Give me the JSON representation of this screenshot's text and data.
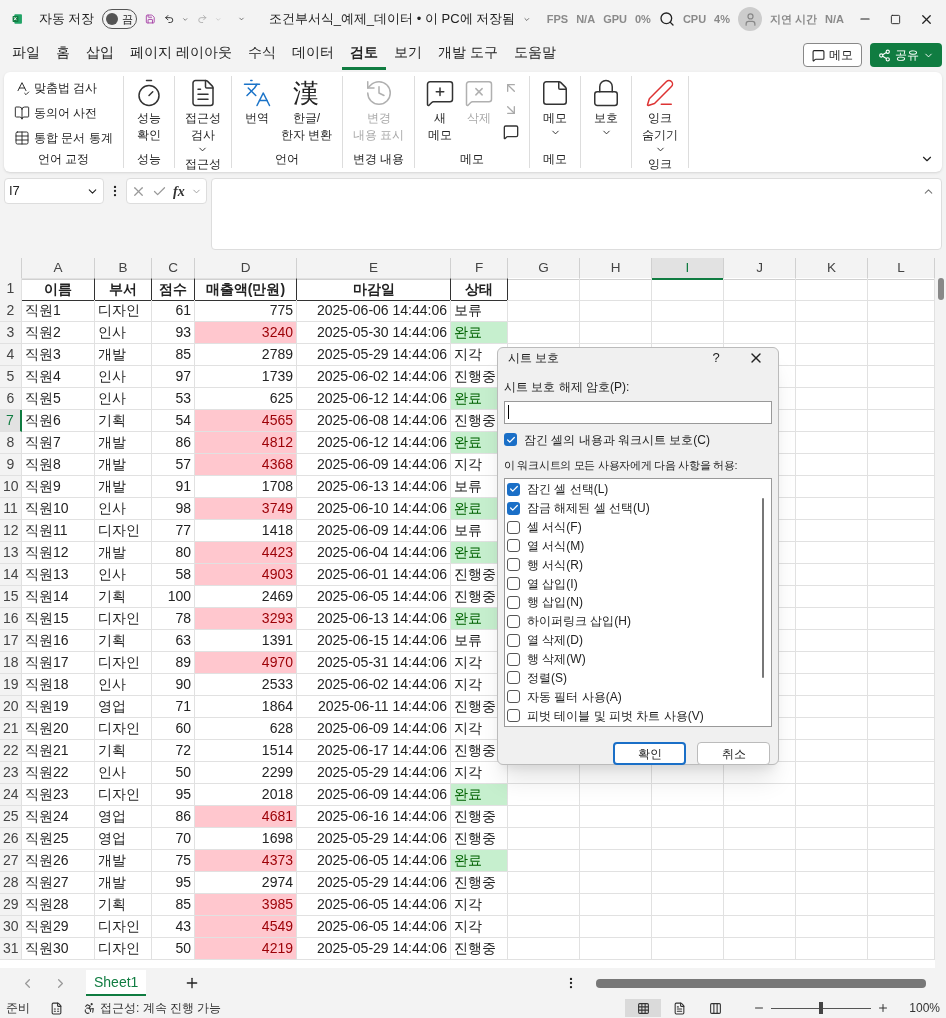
{
  "title_bar": {
    "autosave_label": "자동 저장",
    "autosave_toggle": {
      "label": "끔",
      "on": false
    },
    "title": "조건부서식_예제_데이터 • 이 PC에 저장됨",
    "overlay": [
      "FPS",
      "N/A",
      "GPU",
      "0%",
      "CPU",
      "4%",
      "지연 시간",
      "N/A"
    ]
  },
  "menu_tabs": [
    {
      "label": "파일",
      "selected": false
    },
    {
      "label": "홈",
      "selected": false
    },
    {
      "label": "삽입",
      "selected": false
    },
    {
      "label": "페이지 레이아웃",
      "selected": false
    },
    {
      "label": "수식",
      "selected": false
    },
    {
      "label": "데이터",
      "selected": false
    },
    {
      "label": "검토",
      "selected": true
    },
    {
      "label": "보기",
      "selected": false
    },
    {
      "label": "개발 도구",
      "selected": false
    },
    {
      "label": "도움말",
      "selected": false
    }
  ],
  "comment_button": "메모",
  "share_button": "공유",
  "ribbon": [
    {
      "label": "언어 교정",
      "buttons": [
        {
          "kind": "small",
          "lines": [
            "맞춤법 검사"
          ],
          "disabled": false
        },
        {
          "kind": "small",
          "lines": [
            "동의어 사전"
          ],
          "disabled": false
        },
        {
          "kind": "small",
          "lines": [
            "통합 문서 통계"
          ],
          "disabled": false
        }
      ]
    },
    {
      "label": "성능",
      "buttons": [
        {
          "kind": "large",
          "lines": [
            "성능",
            "확인"
          ],
          "disabled": false
        }
      ]
    },
    {
      "label": "접근성",
      "buttons": [
        {
          "kind": "large",
          "lines": [
            "접근성",
            "검사"
          ],
          "dropdown": true,
          "disabled": false
        }
      ]
    },
    {
      "label": "언어",
      "buttons": [
        {
          "kind": "large",
          "lines": [
            "번역"
          ],
          "disabled": false
        },
        {
          "kind": "large",
          "glyph": "漢",
          "lines": [
            "한글/",
            "한자 변환"
          ],
          "disabled": false
        }
      ]
    },
    {
      "label": "변경 내용",
      "buttons": [
        {
          "kind": "large",
          "lines": [
            "변경",
            "내용 표시"
          ],
          "disabled": true
        }
      ]
    },
    {
      "label": "메모",
      "buttons": [
        {
          "kind": "large",
          "lines": [
            "새",
            "메모"
          ],
          "disabled": false
        },
        {
          "kind": "large",
          "lines": [
            "삭제"
          ],
          "disabled": true
        },
        {
          "kind": "icons",
          "disabled": true
        }
      ]
    },
    {
      "label": "메모",
      "buttons": [
        {
          "kind": "large",
          "lines": [
            "메모"
          ],
          "dropdown": true,
          "disabled": false
        }
      ]
    },
    {
      "buttons": [
        {
          "kind": "large",
          "lines": [
            "보호"
          ],
          "dropdown": true,
          "disabled": false
        }
      ]
    },
    {
      "label": "잉크",
      "buttons": [
        {
          "kind": "large",
          "lines": [
            "잉크",
            "숨기기"
          ],
          "dropdown": true,
          "disabled": false
        }
      ]
    }
  ],
  "formula_bar": {
    "name_box": "I7",
    "fx": "fx"
  },
  "columns": [
    {
      "letter": "A",
      "selected": false
    },
    {
      "letter": "B",
      "selected": false
    },
    {
      "letter": "C",
      "selected": false
    },
    {
      "letter": "D",
      "selected": false
    },
    {
      "letter": "E",
      "selected": false
    },
    {
      "letter": "F",
      "selected": false
    },
    {
      "letter": "G",
      "selected": false
    },
    {
      "letter": "H",
      "selected": false
    },
    {
      "letter": "I",
      "selected": true
    },
    {
      "letter": "J",
      "selected": false
    },
    {
      "letter": "K",
      "selected": false
    },
    {
      "letter": "L",
      "selected": false
    }
  ],
  "header_row": {
    "row": "1",
    "cells": [
      "이름",
      "부서",
      "점수",
      "매출액(만원)",
      "마감일",
      "상태"
    ]
  },
  "rows": [
    {
      "row": "2",
      "name": "직원1",
      "dept": "디자인",
      "score": "61",
      "sales": "775",
      "sales_high": false,
      "deadline": "2025-06-06 14:44:06",
      "status": "보류",
      "status_done": false,
      "selected": false
    },
    {
      "row": "3",
      "name": "직원2",
      "dept": "인사",
      "score": "93",
      "sales": "3240",
      "sales_high": true,
      "deadline": "2025-05-30 14:44:06",
      "status": "완료",
      "status_done": true,
      "selected": false
    },
    {
      "row": "4",
      "name": "직원3",
      "dept": "개발",
      "score": "85",
      "sales": "2789",
      "sales_high": false,
      "deadline": "2025-05-29 14:44:06",
      "status": "지각",
      "status_done": false,
      "selected": false
    },
    {
      "row": "5",
      "name": "직원4",
      "dept": "인사",
      "score": "97",
      "sales": "1739",
      "sales_high": false,
      "deadline": "2025-06-02 14:44:06",
      "status": "진행중",
      "status_done": false,
      "selected": false
    },
    {
      "row": "6",
      "name": "직원5",
      "dept": "인사",
      "score": "53",
      "sales": "625",
      "sales_high": false,
      "deadline": "2025-06-12 14:44:06",
      "status": "완료",
      "status_done": true,
      "selected": false
    },
    {
      "row": "7",
      "name": "직원6",
      "dept": "기획",
      "score": "54",
      "sales": "4565",
      "sales_high": true,
      "deadline": "2025-06-08 14:44:06",
      "status": "진행중",
      "status_done": false,
      "selected": true
    },
    {
      "row": "8",
      "name": "직원7",
      "dept": "개발",
      "score": "86",
      "sales": "4812",
      "sales_high": true,
      "deadline": "2025-06-12 14:44:06",
      "status": "완료",
      "status_done": true,
      "selected": false
    },
    {
      "row": "9",
      "name": "직원8",
      "dept": "개발",
      "score": "57",
      "sales": "4368",
      "sales_high": true,
      "deadline": "2025-06-09 14:44:06",
      "status": "지각",
      "status_done": false,
      "selected": false
    },
    {
      "row": "10",
      "name": "직원9",
      "dept": "개발",
      "score": "91",
      "sales": "1708",
      "sales_high": false,
      "deadline": "2025-06-13 14:44:06",
      "status": "보류",
      "status_done": false,
      "selected": false
    },
    {
      "row": "11",
      "name": "직원10",
      "dept": "인사",
      "score": "98",
      "sales": "3749",
      "sales_high": true,
      "deadline": "2025-06-10 14:44:06",
      "status": "완료",
      "status_done": true,
      "selected": false
    },
    {
      "row": "12",
      "name": "직원11",
      "dept": "디자인",
      "score": "77",
      "sales": "1418",
      "sales_high": false,
      "deadline": "2025-06-09 14:44:06",
      "status": "보류",
      "status_done": false,
      "selected": false
    },
    {
      "row": "13",
      "name": "직원12",
      "dept": "개발",
      "score": "80",
      "sales": "4423",
      "sales_high": true,
      "deadline": "2025-06-04 14:44:06",
      "status": "완료",
      "status_done": true,
      "selected": false
    },
    {
      "row": "14",
      "name": "직원13",
      "dept": "인사",
      "score": "58",
      "sales": "4903",
      "sales_high": true,
      "deadline": "2025-06-01 14:44:06",
      "status": "진행중",
      "status_done": false,
      "selected": false
    },
    {
      "row": "15",
      "name": "직원14",
      "dept": "기획",
      "score": "100",
      "sales": "2469",
      "sales_high": false,
      "deadline": "2025-06-05 14:44:06",
      "status": "진행중",
      "status_done": false,
      "selected": false
    },
    {
      "row": "16",
      "name": "직원15",
      "dept": "디자인",
      "score": "78",
      "sales": "3293",
      "sales_high": true,
      "deadline": "2025-06-13 14:44:06",
      "status": "완료",
      "status_done": true,
      "selected": false
    },
    {
      "row": "17",
      "name": "직원16",
      "dept": "기획",
      "score": "63",
      "sales": "1391",
      "sales_high": false,
      "deadline": "2025-06-15 14:44:06",
      "status": "보류",
      "status_done": false,
      "selected": false
    },
    {
      "row": "18",
      "name": "직원17",
      "dept": "디자인",
      "score": "89",
      "sales": "4970",
      "sales_high": true,
      "deadline": "2025-05-31 14:44:06",
      "status": "지각",
      "status_done": false,
      "selected": false
    },
    {
      "row": "19",
      "name": "직원18",
      "dept": "인사",
      "score": "90",
      "sales": "2533",
      "sales_high": false,
      "deadline": "2025-06-02 14:44:06",
      "status": "지각",
      "status_done": false,
      "selected": false
    },
    {
      "row": "20",
      "name": "직원19",
      "dept": "영업",
      "score": "71",
      "sales": "1864",
      "sales_high": false,
      "deadline": "2025-06-11 14:44:06",
      "status": "진행중",
      "status_done": false,
      "selected": false
    },
    {
      "row": "21",
      "name": "직원20",
      "dept": "디자인",
      "score": "60",
      "sales": "628",
      "sales_high": false,
      "deadline": "2025-06-09 14:44:06",
      "status": "지각",
      "status_done": false,
      "selected": false
    },
    {
      "row": "22",
      "name": "직원21",
      "dept": "기획",
      "score": "72",
      "sales": "1514",
      "sales_high": false,
      "deadline": "2025-06-17 14:44:06",
      "status": "진행중",
      "status_done": false,
      "selected": false
    },
    {
      "row": "23",
      "name": "직원22",
      "dept": "인사",
      "score": "50",
      "sales": "2299",
      "sales_high": false,
      "deadline": "2025-05-29 14:44:06",
      "status": "지각",
      "status_done": false,
      "selected": false
    },
    {
      "row": "24",
      "name": "직원23",
      "dept": "디자인",
      "score": "95",
      "sales": "2018",
      "sales_high": false,
      "deadline": "2025-06-09 14:44:06",
      "status": "완료",
      "status_done": true,
      "selected": false
    },
    {
      "row": "25",
      "name": "직원24",
      "dept": "영업",
      "score": "86",
      "sales": "4681",
      "sales_high": true,
      "deadline": "2025-06-16 14:44:06",
      "status": "진행중",
      "status_done": false,
      "selected": false
    },
    {
      "row": "26",
      "name": "직원25",
      "dept": "영업",
      "score": "70",
      "sales": "1698",
      "sales_high": false,
      "deadline": "2025-05-29 14:44:06",
      "status": "진행중",
      "status_done": false,
      "selected": false
    },
    {
      "row": "27",
      "name": "직원26",
      "dept": "개발",
      "score": "75",
      "sales": "4373",
      "sales_high": true,
      "deadline": "2025-06-05 14:44:06",
      "status": "완료",
      "status_done": true,
      "selected": false
    },
    {
      "row": "28",
      "name": "직원27",
      "dept": "개발",
      "score": "95",
      "sales": "2974",
      "sales_high": false,
      "deadline": "2025-05-29 14:44:06",
      "status": "진행중",
      "status_done": false,
      "selected": false
    },
    {
      "row": "29",
      "name": "직원28",
      "dept": "기획",
      "score": "85",
      "sales": "3985",
      "sales_high": true,
      "deadline": "2025-06-05 14:44:06",
      "status": "지각",
      "status_done": false,
      "selected": false
    },
    {
      "row": "30",
      "name": "직원29",
      "dept": "디자인",
      "score": "43",
      "sales": "4549",
      "sales_high": true,
      "deadline": "2025-06-05 14:44:06",
      "status": "지각",
      "status_done": false,
      "selected": false
    },
    {
      "row": "31",
      "name": "직원30",
      "dept": "디자인",
      "score": "50",
      "sales": "4219",
      "sales_high": true,
      "deadline": "2025-05-29 14:44:06",
      "status": "진행중",
      "status_done": false,
      "selected": false
    }
  ],
  "sheet_tabs": [
    {
      "label": "Sheet1",
      "selected": true
    }
  ],
  "status_bar": {
    "ready": "준비",
    "accessibility": "접근성: 계속 진행 가능",
    "views": [
      {
        "selected": true
      },
      {
        "selected": false
      },
      {
        "selected": false
      }
    ],
    "zoom": {
      "level": 0.5
    },
    "zoom_label": "100%"
  },
  "dialog": {
    "title": "시트 보호",
    "help": "?",
    "password_label": "시트 보호 해제 암호(P):",
    "protect": {
      "label": "잠긴 셀의 내용과 워크시트 보호(C)",
      "checked": true
    },
    "allow_label": "이 워크시트의 모든 사용자에게 다음 사항을 허용:",
    "permissions": [
      {
        "label": "잠긴 셀 선택(L)",
        "checked": true
      },
      {
        "label": "잠금 해제된 셀 선택(U)",
        "checked": true
      },
      {
        "label": "셀 서식(F)",
        "checked": false
      },
      {
        "label": "열 서식(M)",
        "checked": false
      },
      {
        "label": "행 서식(R)",
        "checked": false
      },
      {
        "label": "열 삽입(I)",
        "checked": false
      },
      {
        "label": "행 삽입(N)",
        "checked": false
      },
      {
        "label": "하이퍼링크 삽입(H)",
        "checked": false
      },
      {
        "label": "열 삭제(D)",
        "checked": false
      },
      {
        "label": "행 삭제(W)",
        "checked": false
      },
      {
        "label": "정렬(S)",
        "checked": false
      },
      {
        "label": "자동 필터 사용(A)",
        "checked": false
      },
      {
        "label": "피벗 테이블 및 피벗 차트 사용(V)",
        "checked": false
      }
    ],
    "ok": "확인",
    "cancel": "취소"
  }
}
